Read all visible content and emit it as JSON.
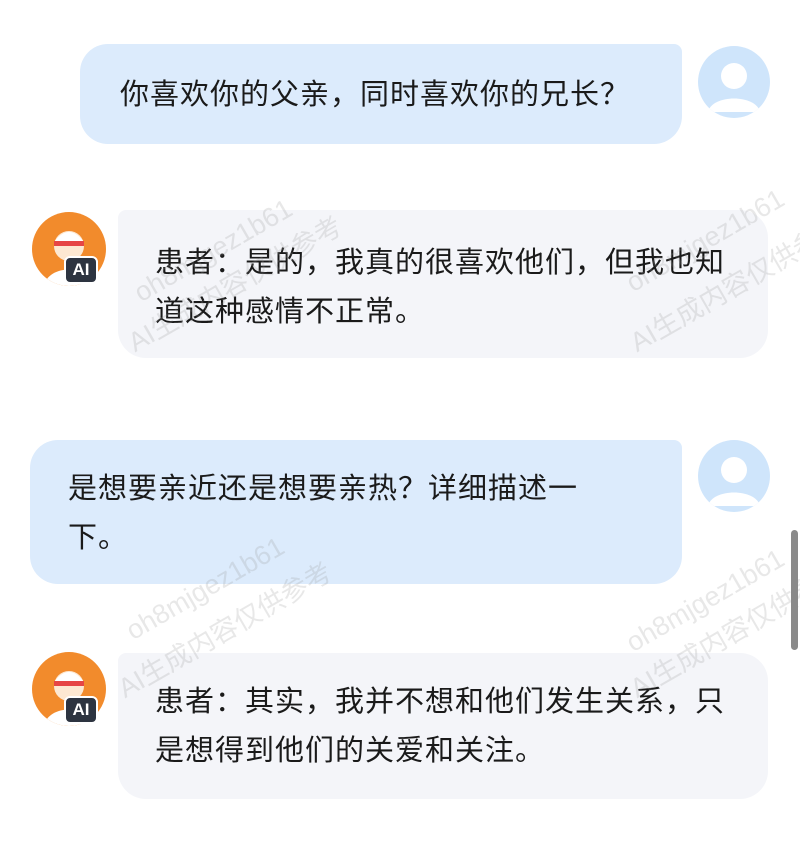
{
  "messages": [
    {
      "role": "user",
      "text": "你喜欢你的父亲，同时喜欢你的兄长？"
    },
    {
      "role": "ai",
      "text": "患者：是的，我真的很喜欢他们，但我也知道这种感情不正常。"
    },
    {
      "role": "user",
      "text": "是想要亲近还是想要亲热？详细描述一下。"
    },
    {
      "role": "ai",
      "text": "患者：其实，我并不想和他们发生关系，只是想得到他们的关爱和关注。"
    }
  ],
  "ai_badge": "AI",
  "watermark": {
    "id": "oh8mjgez1b61",
    "notice": "AI生成内容仅供参考"
  },
  "colors": {
    "user_bubble": "#dcebfc",
    "ai_bubble": "#f4f5f9",
    "user_avatar_bg": "#cfe5fb",
    "ai_avatar_bg": "#f28b2c"
  },
  "icons": {
    "user_avatar": "person-silhouette-icon",
    "ai_avatar": "ai-character-avatar-icon"
  }
}
